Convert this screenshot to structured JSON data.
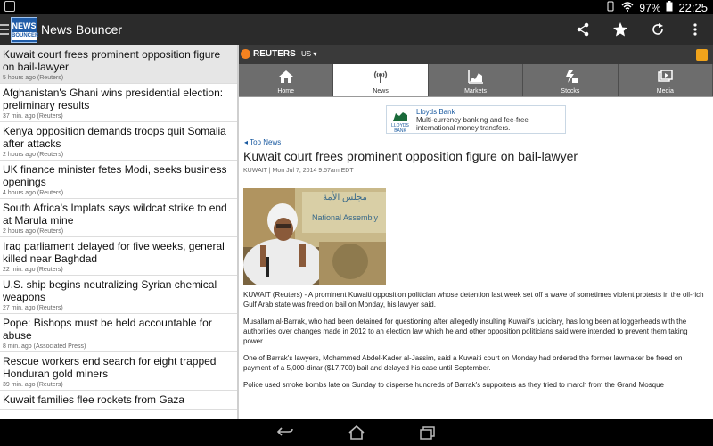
{
  "status_bar": {
    "battery": "97%",
    "time": "22:25"
  },
  "app": {
    "logo_text_top": "NEWS",
    "logo_text_bottom": "BOUNCER",
    "title": "News Bouncer",
    "actions": [
      "share-icon",
      "star-icon",
      "refresh-icon",
      "overflow-menu-icon"
    ]
  },
  "articles": [
    {
      "headline": "Kuwait court frees prominent opposition figure on bail-lawyer",
      "meta": "5 hours ago (Reuters)"
    },
    {
      "headline": "Afghanistan's Ghani wins presidential election: preliminary results",
      "meta": "37 min. ago (Reuters)"
    },
    {
      "headline": "Kenya opposition demands troops quit Somalia after attacks",
      "meta": "2 hours ago (Reuters)"
    },
    {
      "headline": "UK finance minister fetes Modi, seeks business openings",
      "meta": "4 hours ago (Reuters)"
    },
    {
      "headline": "South Africa's Implats says wildcat strike to end at Marula mine",
      "meta": "2 hours ago (Reuters)"
    },
    {
      "headline": "Iraq parliament delayed for five weeks, general killed near Baghdad",
      "meta": "22 min. ago (Reuters)"
    },
    {
      "headline": "U.S. ship begins neutralizing Syrian chemical weapons",
      "meta": "27 min. ago (Reuters)"
    },
    {
      "headline": "Pope: Bishops must be held accountable for abuse",
      "meta": "8 min. ago (Associated Press)"
    },
    {
      "headline": "Rescue workers end search for eight trapped Honduran gold miners",
      "meta": "39 min. ago (Reuters)"
    },
    {
      "headline": "Kuwait families flee rockets from Gaza",
      "meta": ""
    }
  ],
  "web": {
    "brand": "REUTERS",
    "edition": "US",
    "tabs": [
      {
        "label": "Home",
        "icon": "home-icon",
        "active": false
      },
      {
        "label": "News",
        "icon": "antenna-icon",
        "active": true
      },
      {
        "label": "Markets",
        "icon": "chart-icon",
        "active": false
      },
      {
        "label": "Stocks",
        "icon": "stocks-icon",
        "active": false
      },
      {
        "label": "Media",
        "icon": "media-icon",
        "active": false
      }
    ],
    "ad": {
      "logo": "LLOYDS BANK",
      "title": "Lloyds Bank",
      "text1": "Multi-currency banking and fee-free",
      "text2": "international money transfers."
    },
    "crumb": "Top News",
    "headline": "Kuwait court frees prominent opposition figure on bail-lawyer",
    "dateline": "KUWAIT | Mon Jul 7, 2014 9:57am EDT",
    "photo_sign_line1": "مجلس الأمة",
    "photo_sign_line2": "National Assembly",
    "paragraphs": [
      "KUWAIT (Reuters) - A prominent Kuwaiti opposition politician whose detention last week set off a wave of sometimes violent protests in the oil-rich Gulf Arab state was freed on bail on Monday, his lawyer said.",
      "Musallam al-Barrak, who had been detained for questioning after allegedly insulting Kuwait's judiciary, has long been at loggerheads with the authorities over changes made in 2012 to an election law which he and other opposition politicians said were intended to prevent them taking power.",
      "One of Barrak's lawyers, Mohammed Abdel-Kader al-Jassim, said a Kuwaiti court on Monday had ordered the former lawmaker be freed on payment of a 5,000-dinar ($17,700) bail and delayed his case until September.",
      "Police used smoke bombs late on Sunday to disperse hundreds of Barrak's supporters as they tried to march from the Grand Mosque"
    ]
  }
}
